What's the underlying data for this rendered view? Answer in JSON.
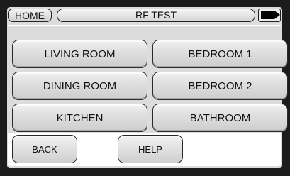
{
  "header": {
    "home_label": "HOME",
    "title": "RF TEST",
    "battery_icon": "battery-icon"
  },
  "rooms": [
    {
      "label": "LIVING ROOM"
    },
    {
      "label": "BEDROOM 1"
    },
    {
      "label": "DINING ROOM"
    },
    {
      "label": "BEDROOM 2"
    },
    {
      "label": "KITCHEN"
    },
    {
      "label": "BATHROOM"
    }
  ],
  "footer": {
    "back_label": "BACK",
    "help_label": "HELP"
  }
}
